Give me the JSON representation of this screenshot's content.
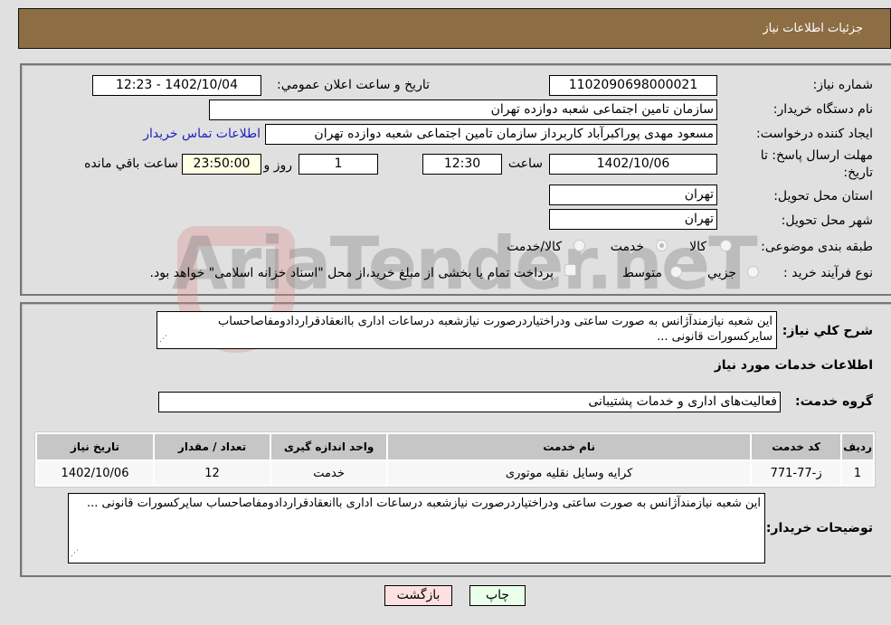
{
  "header": {
    "title": "جزئیات اطلاعات نیاز"
  },
  "form": {
    "need_number": {
      "label": "شماره نیاز:",
      "value": "1102090698000021"
    },
    "announce_datetime": {
      "label": "تاریخ و ساعت اعلان عمومي:",
      "value": "1402/10/04 - 12:23"
    },
    "buyer_org": {
      "label": "نام دستگاه خريدار:",
      "value": "سازمان تامین اجتماعی شعبه دوازده تهران"
    },
    "requester": {
      "label": "ایجاد کننده درخواست:",
      "value": "مسعود مهدی پوراکبرآباد کاربرداز سازمان تامین اجتماعی شعبه دوازده تهران",
      "contact_link": "اطلاعات تماس خریدار"
    },
    "deadline": {
      "label_line1": "مهلت ارسال پاسخ: تا",
      "label_line2": "تاریخ:",
      "date": "1402/10/06",
      "time_label": "ساعت",
      "time": "12:30",
      "days": "1",
      "days_label": "روز و",
      "remaining": "23:50:00",
      "remaining_label": "ساعت باقي مانده"
    },
    "province": {
      "label": "استان محل تحویل:",
      "value": "تهران"
    },
    "city": {
      "label": "شهر محل تحویل:",
      "value": "تهران"
    },
    "category": {
      "label": "طبقه بندی موضوعی:",
      "options": [
        "کالا",
        "خدمت",
        "کالا/خدمت"
      ],
      "selected": "خدمت"
    },
    "purchase_type": {
      "label": "نوع فرآیند خرید :",
      "options": [
        "جزيي",
        "متوسط"
      ],
      "treasury_note": "پرداخت تمام یا بخشی از مبلغ خرید،از محل \"اسناد خزانه اسلامی\" خواهد بود."
    }
  },
  "details": {
    "general_desc_label": "شرح کلي نياز:",
    "general_desc": "این شعبه نیازمندآژانس به صورت ساعتی ودراختیاردرصورت نیازشعبه درساعات اداری باانعقادقراردادومفاصاحساب سایرکسورات قانونی ...",
    "services_heading": "اطلاعات خدمات مورد نياز",
    "service_group_label": "گروه خدمت:",
    "service_group": "فعالیت‌های اداری و خدمات پشتیبانی",
    "table": {
      "headers": [
        "رديف",
        "کد خدمت",
        "نام خدمت",
        "واحد اندازه گيری",
        "تعداد / مقدار",
        "تاریخ نیاز"
      ],
      "rows": [
        [
          "1",
          "ز-77-771",
          "کرایه وسایل نقلیه موتوری",
          "خدمت",
          "12",
          "1402/10/06"
        ]
      ]
    },
    "buyer_notes_label": "توضيحات خريدار:",
    "buyer_notes": "این شعبه نیازمندآژانس به صورت ساعتی ودراختیاردرصورت نیازشعبه درساعات اداری باانعقادقراردادومفاصاحساب سایرکسورات قانونی ..."
  },
  "buttons": {
    "print": "چاپ",
    "back": "بازگشت"
  },
  "watermark": "AriaTender.neT"
}
